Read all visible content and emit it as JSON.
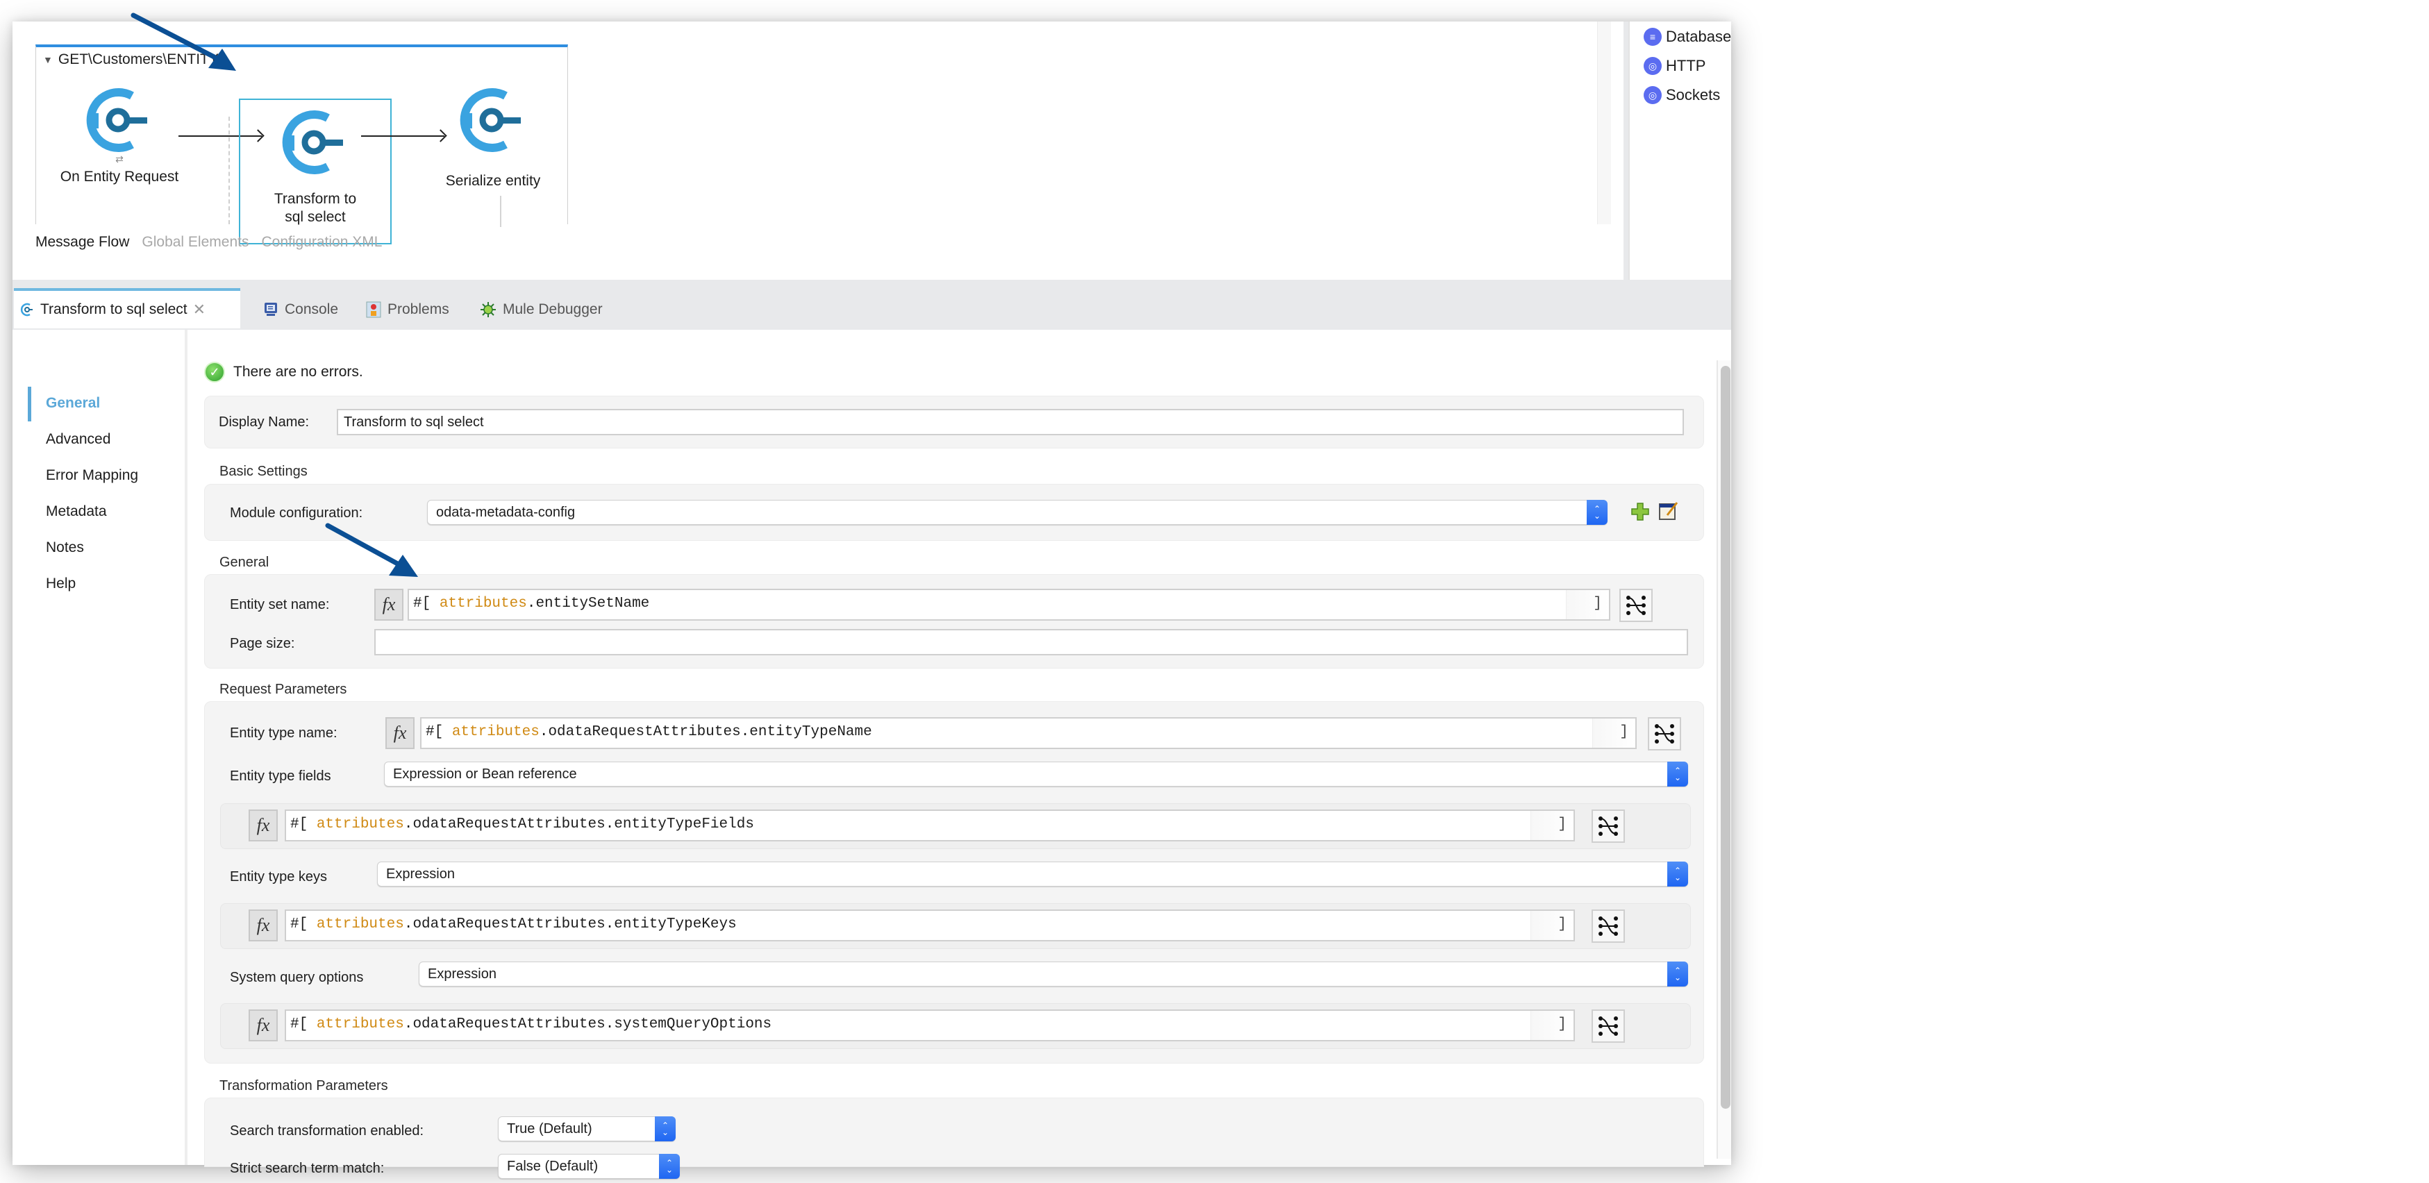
{
  "canvas": {
    "flow_title": "GET\\Customers\\ENTITY",
    "nodes": [
      {
        "label": "On Entity Request"
      },
      {
        "label": "Transform to sql select",
        "selected": true
      },
      {
        "label": "Serialize entity"
      }
    ],
    "tabs": [
      {
        "label": "Message Flow",
        "active": true
      },
      {
        "label": "Global Elements"
      },
      {
        "label": "Configuration XML"
      }
    ]
  },
  "palette": {
    "items": [
      {
        "label": "Database",
        "icon": "database-icon"
      },
      {
        "label": "HTTP",
        "icon": "http-icon"
      },
      {
        "label": "Sockets",
        "icon": "sockets-icon"
      }
    ]
  },
  "tabs": [
    {
      "label": "Transform to sql select",
      "icon": "mule-component-icon",
      "active": true,
      "closable": true
    },
    {
      "label": "Console",
      "icon": "console-icon"
    },
    {
      "label": "Problems",
      "icon": "problems-icon"
    },
    {
      "label": "Mule Debugger",
      "icon": "debugger-bug-icon"
    }
  ],
  "leftnav": {
    "items": [
      {
        "label": "General",
        "active": true
      },
      {
        "label": "Advanced"
      },
      {
        "label": "Error Mapping"
      },
      {
        "label": "Metadata"
      },
      {
        "label": "Notes"
      },
      {
        "label": "Help"
      }
    ]
  },
  "status": {
    "text": "There are no errors."
  },
  "form": {
    "display_name": {
      "label": "Display Name:",
      "value": "Transform to sql select"
    },
    "basic_settings": {
      "title": "Basic Settings",
      "module_config": {
        "label": "Module configuration:",
        "value": "odata-metadata-config"
      }
    },
    "general": {
      "title": "General",
      "entity_set_name": {
        "label": "Entity set name:",
        "prefix": "#[ ",
        "kw": "attributes",
        "rest": ".entitySetName",
        "suffix": "]"
      },
      "page_size": {
        "label": "Page size:",
        "value": ""
      }
    },
    "request_parameters": {
      "title": "Request Parameters",
      "entity_type_name": {
        "label": "Entity type name:",
        "prefix": "#[ ",
        "kw": "attributes",
        "rest": ".odataRequestAttributes.entityTypeName",
        "suffix": "]"
      },
      "entity_type_fields": {
        "label": "Entity type fields",
        "select": "Expression or Bean reference",
        "prefix": "#[ ",
        "kw": "attributes",
        "rest": ".odataRequestAttributes.entityTypeFields",
        "suffix": "]"
      },
      "entity_type_keys": {
        "label": "Entity type keys",
        "select": "Expression",
        "prefix": "#[ ",
        "kw": "attributes",
        "rest": ".odataRequestAttributes.entityTypeKeys",
        "suffix": "]"
      },
      "system_query_options": {
        "label": "System query options",
        "select": "Expression",
        "prefix": "#[ ",
        "kw": "attributes",
        "rest": ".odataRequestAttributes.systemQueryOptions",
        "suffix": "]"
      }
    },
    "transformation_parameters": {
      "title": "Transformation Parameters",
      "search_enabled": {
        "label": "Search transformation enabled:",
        "value": "True (Default)"
      },
      "strict_match": {
        "label": "Strict search term match:",
        "value": "False (Default)"
      }
    },
    "fx_label": "fx"
  },
  "colors": {
    "accent": "#5ba8d8",
    "flow_border": "#2f8ee0",
    "expression_keyword": "#d08a14",
    "select_stepper": "#1f66f2",
    "annotation_arrow": "#0b4f94"
  }
}
